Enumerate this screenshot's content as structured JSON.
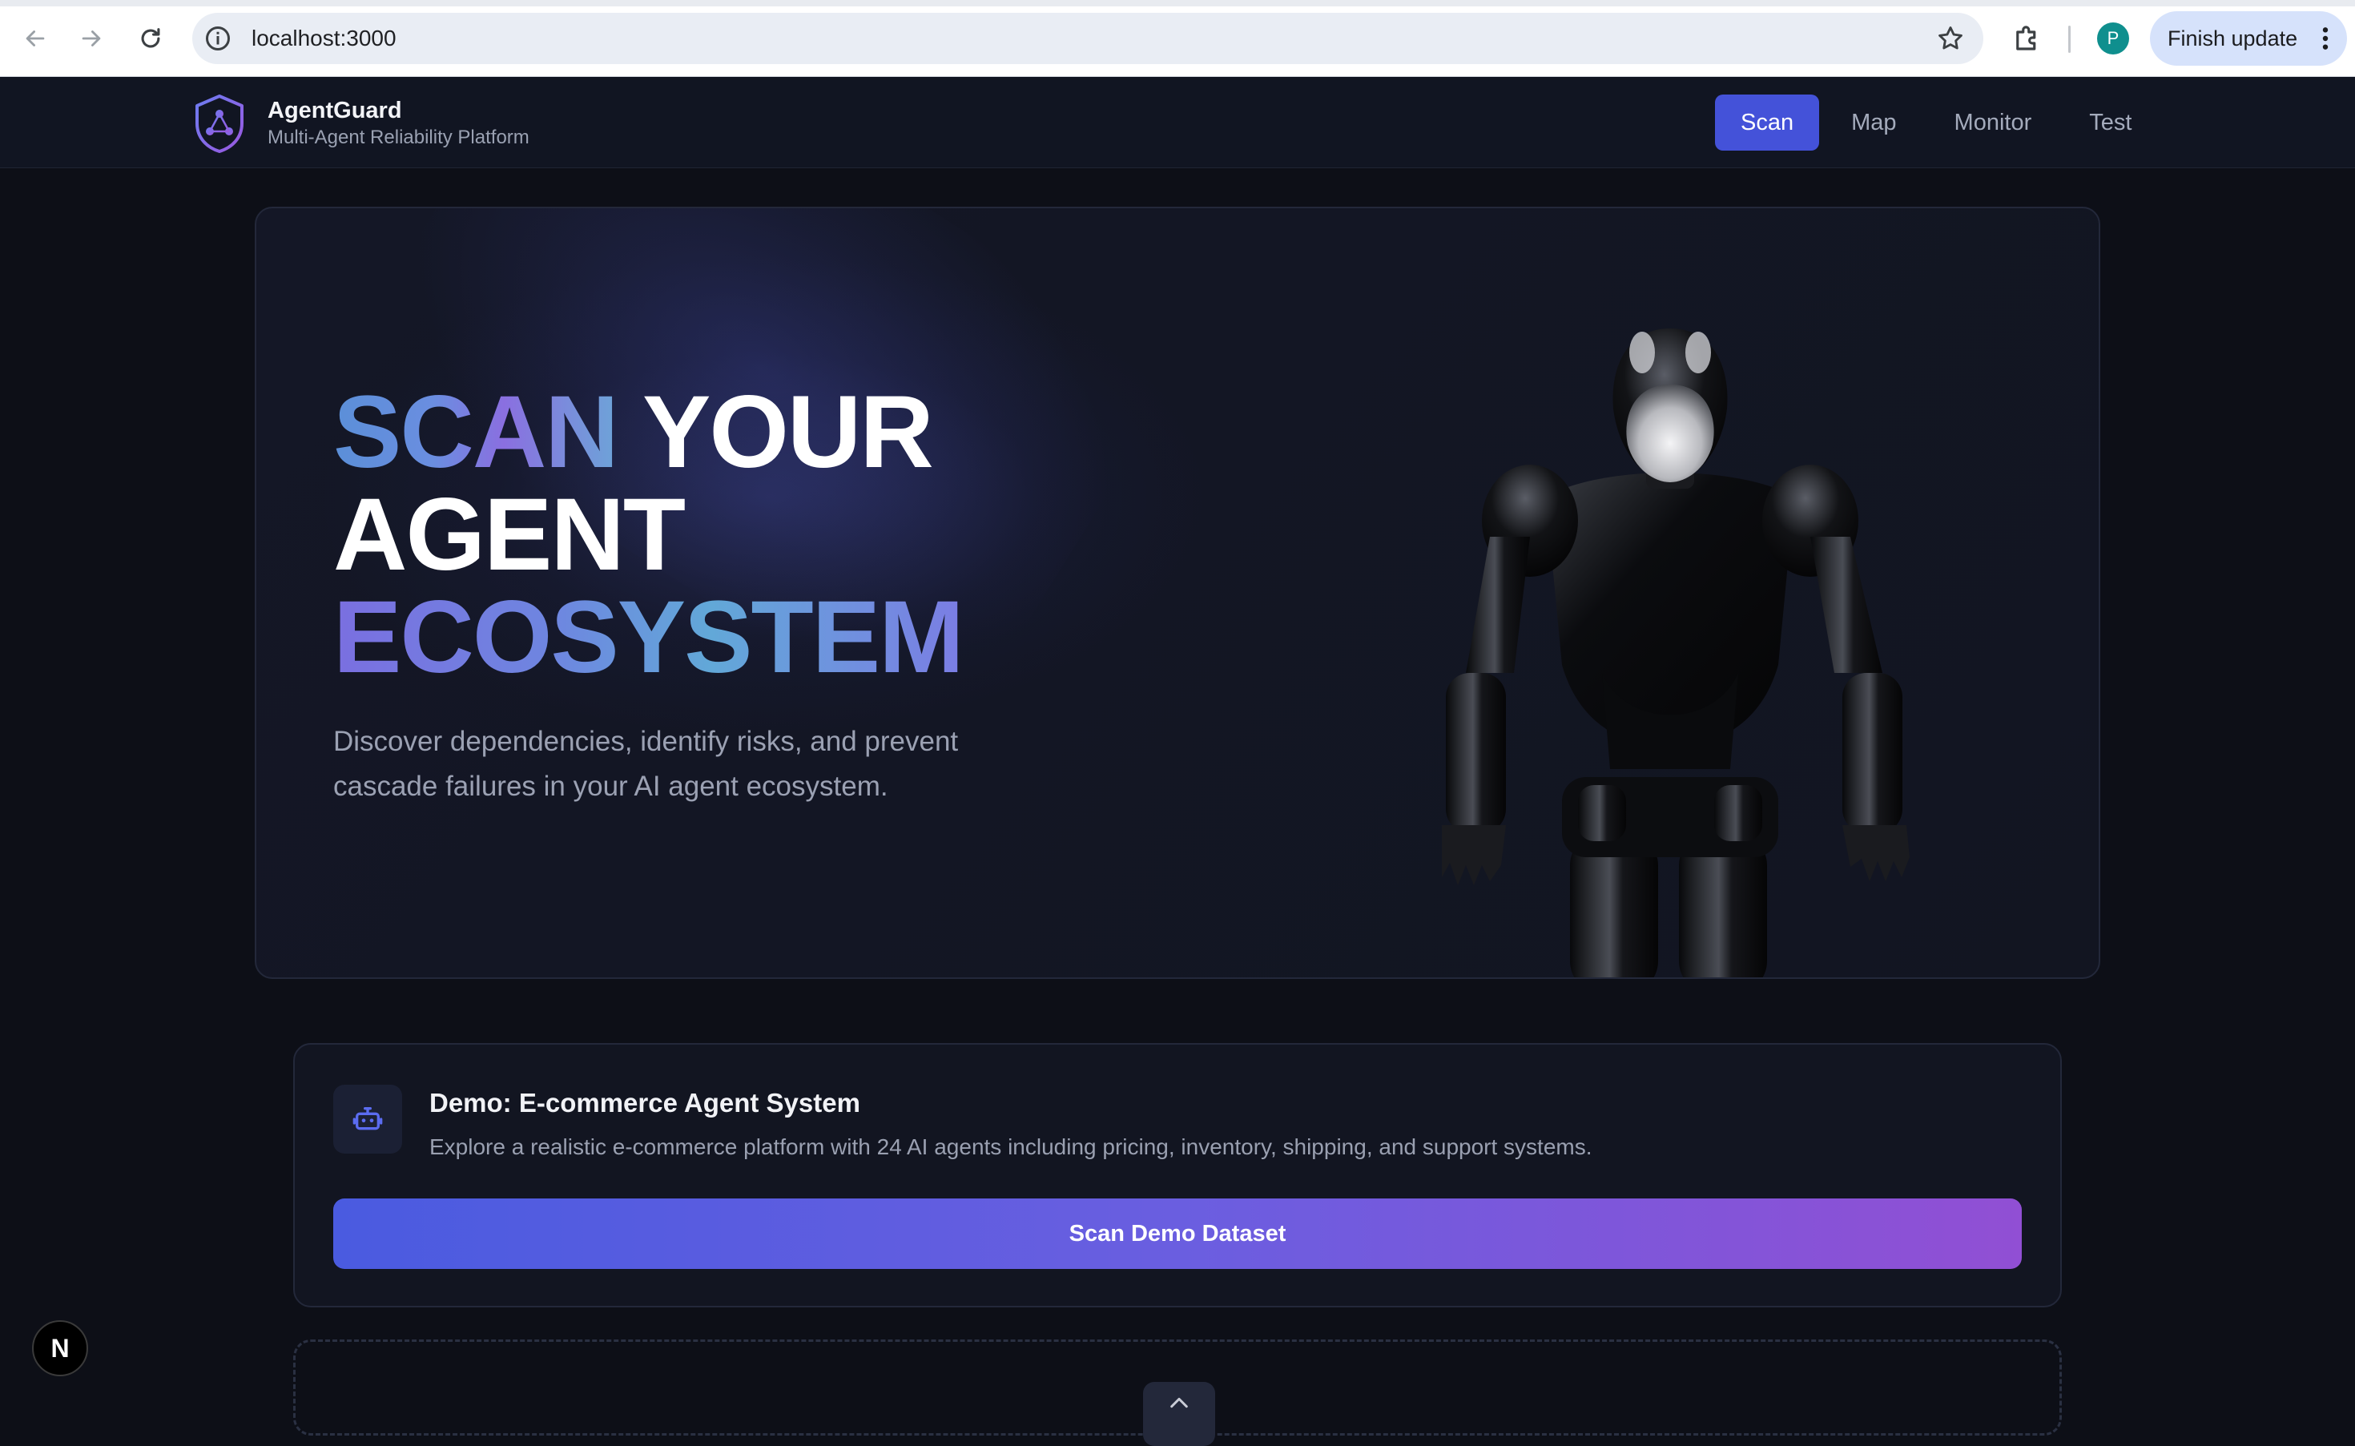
{
  "browser": {
    "url": "localhost:3000",
    "profile_initial": "P",
    "finish_update_label": "Finish update"
  },
  "header": {
    "brand_name": "AgentGuard",
    "brand_subtitle": "Multi-Agent Reliability Platform",
    "tabs": [
      {
        "label": "Scan",
        "active": true
      },
      {
        "label": "Map",
        "active": false
      },
      {
        "label": "Monitor",
        "active": false
      },
      {
        "label": "Test",
        "active": false
      }
    ],
    "accent_color": "#4452d9"
  },
  "hero": {
    "title_word1": "SCAN",
    "title_word2": "YOUR",
    "title_word3": "AGENT",
    "title_word4": "ECOSYSTEM",
    "description": "Discover dependencies, identify risks, and prevent cascade failures in your AI agent ecosystem."
  },
  "demo": {
    "title": "Demo: E-commerce Agent System",
    "description": "Explore a realistic e-commerce platform with 24 AI agents including pricing, inventory, shipping, and support systems.",
    "button_label": "Scan Demo Dataset",
    "icon": "robot-icon"
  },
  "dev_badge": {
    "label": "N"
  }
}
